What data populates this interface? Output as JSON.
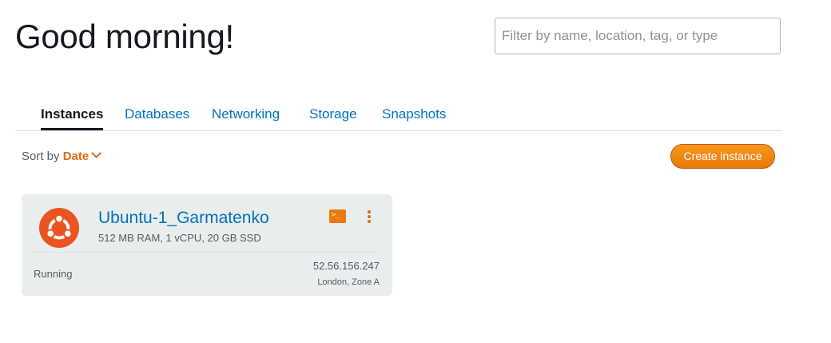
{
  "header": {
    "greeting": "Good morning!"
  },
  "search": {
    "placeholder": "Filter by name, location, tag, or type",
    "value": ""
  },
  "tabs": [
    {
      "label": "Instances",
      "active": true
    },
    {
      "label": "Databases",
      "active": false
    },
    {
      "label": "Networking",
      "active": false
    },
    {
      "label": "Storage",
      "active": false
    },
    {
      "label": "Snapshots",
      "active": false
    }
  ],
  "sort": {
    "label": "Sort by",
    "value": "Date"
  },
  "actions": {
    "create_label": "Create instance"
  },
  "instance": {
    "name": "Ubuntu-1_Garmatenko",
    "specs": "512 MB RAM, 1 vCPU, 20 GB SSD",
    "status": "Running",
    "ip": "52.56.156.247",
    "location": "London, Zone A",
    "os_icon": "ubuntu-icon",
    "terminal_icon": "terminal-icon",
    "terminal_glyph": ">_",
    "menu_icon": "kebab-menu-icon"
  },
  "colors": {
    "accent": "#dd6b10",
    "link": "#0073bb",
    "ubuntu": "#e95420",
    "card_bg": "#eaeded"
  }
}
